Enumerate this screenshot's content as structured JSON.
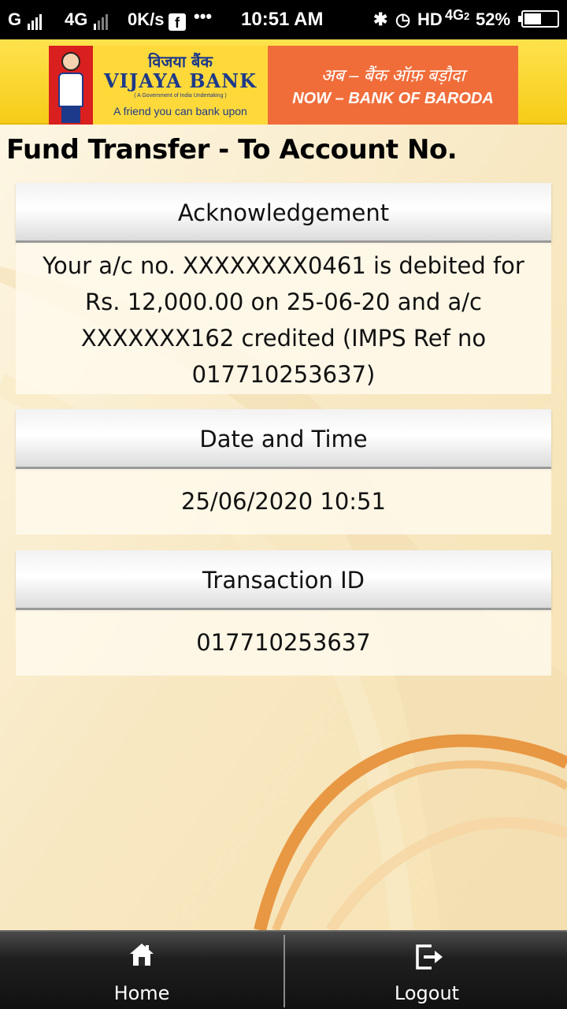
{
  "status_bar": {
    "sim1": "G",
    "sim2": "4G",
    "net_speed": "0K/s",
    "fb_icon": "f",
    "more": "•••",
    "time": "10:51 AM",
    "bluetooth": "✱",
    "alarm": "◷",
    "hd": "HD",
    "lte": "4G",
    "lte_sub": "2",
    "battery_percent": "52%",
    "battery_level": 0.52
  },
  "banner": {
    "hindi_name": "विजया बैंक",
    "bank_name": "VIJAYA BANK",
    "gov_note": "( A Government of India Undertaking )",
    "tagline": "A friend you can bank upon",
    "merger_hindi": "अब – बैंक ऑफ़ बड़ौदा",
    "merger_english": "NOW – BANK OF BARODA"
  },
  "page_title": "Fund Transfer - To Account No.",
  "cards": {
    "acknowledgement": {
      "heading": "Acknowledgement",
      "lines": [
        "Your a/c no. XXXXXXXX0461 is debited for",
        "Rs. 12,000.00 on 25-06-20 and a/c",
        "XXXXXXX162 credited (IMPS Ref no",
        "017710253637)"
      ]
    },
    "date_time": {
      "heading": "Date and Time",
      "value": "25/06/2020 10:51"
    },
    "transaction": {
      "heading": "Transaction ID",
      "value": "017710253637"
    }
  },
  "bottom_nav": {
    "home_label": "Home",
    "logout_label": "Logout"
  },
  "colors": {
    "banner_yellow": "#ffd93a",
    "banner_orange": "#f06d3a",
    "brand_blue": "#1d3a8a",
    "background": "#fbf3dc",
    "swoosh": "#e58a2e"
  }
}
